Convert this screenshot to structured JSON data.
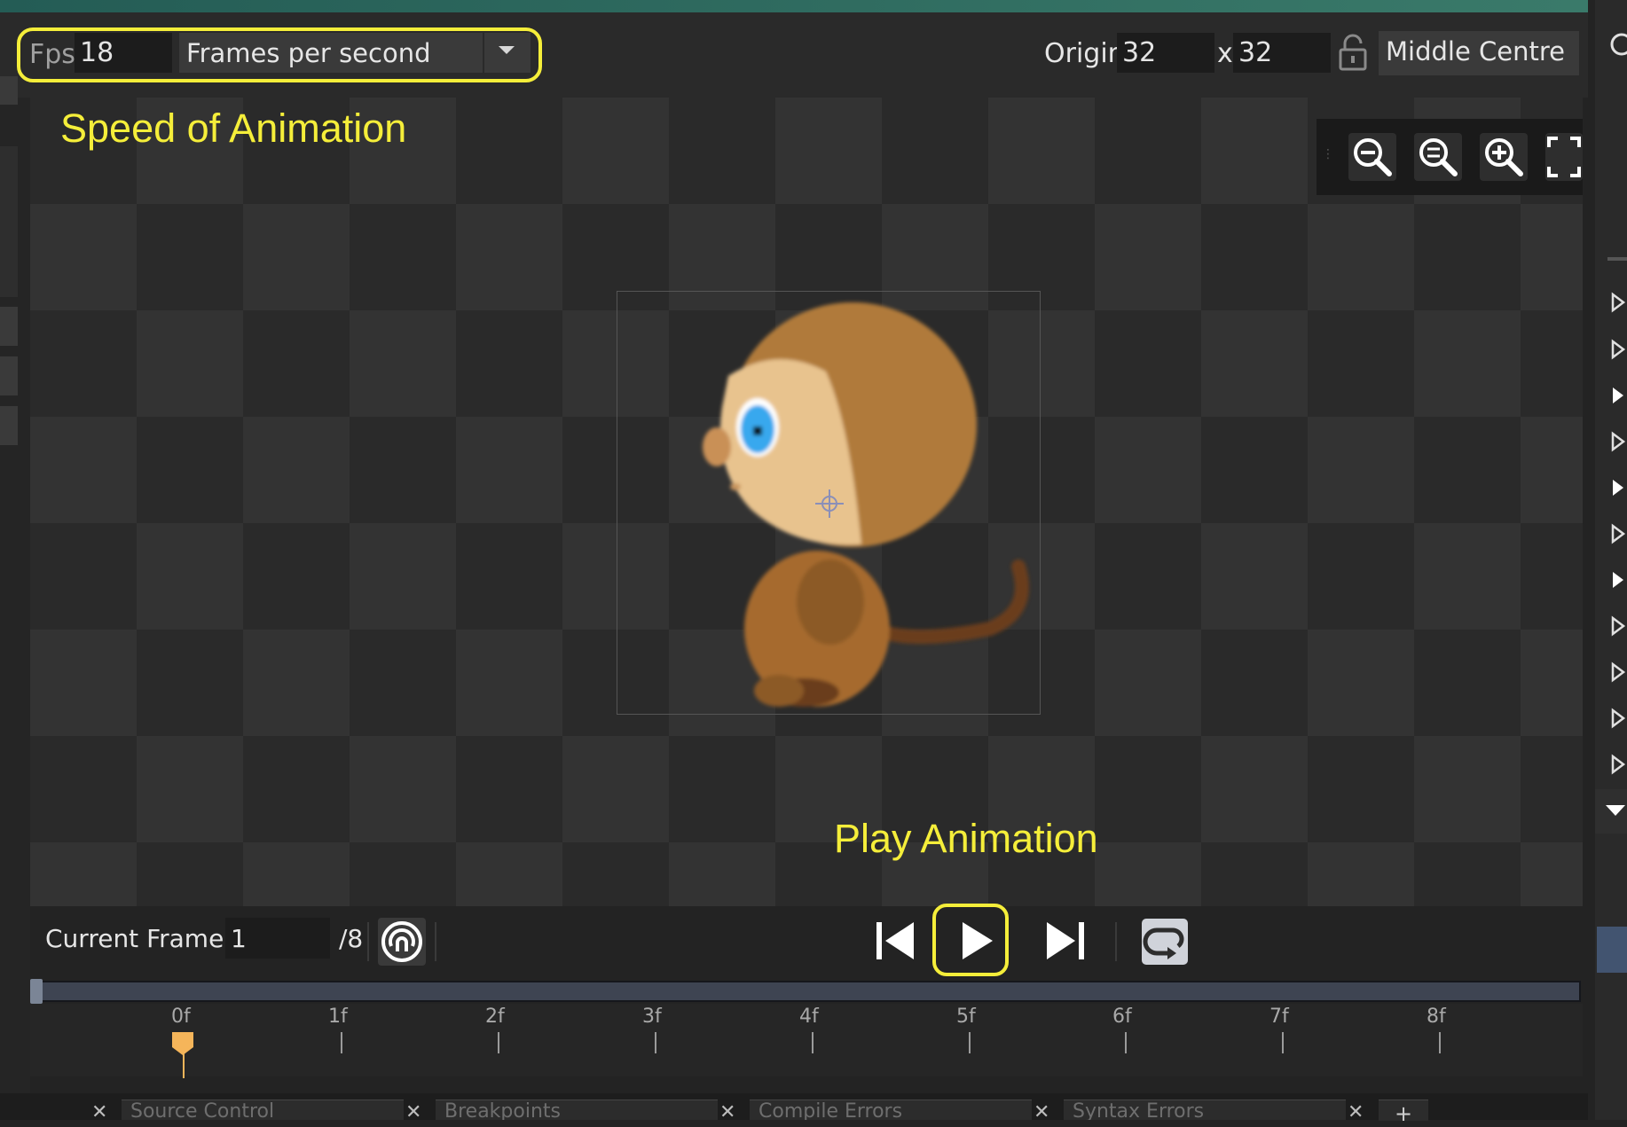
{
  "toolbar": {
    "fps_label": "Fps",
    "fps_value": "18",
    "fps_unit_selected": "Frames per second",
    "origin_label": "Origin",
    "origin_x": "32",
    "origin_separator": "x",
    "origin_y": "32",
    "origin_preset": "Middle Centre"
  },
  "annotations": {
    "speed": "Speed of Animation",
    "play": "Play Animation",
    "highlight_color": "#f5ee3a"
  },
  "zoom": {
    "buttons": [
      "zoom-out-icon",
      "zoom-reset-icon",
      "zoom-in-icon",
      "fit-to-screen-icon"
    ]
  },
  "playback": {
    "current_frame_label": "Current Frame:",
    "current_frame_value": "1",
    "total_frames": "/8",
    "buttons": [
      "onion-skin-icon",
      "skip-to-start-icon",
      "play-icon",
      "skip-to-end-icon",
      "loop-icon"
    ]
  },
  "timeline": {
    "ticks": [
      "0f",
      "1f",
      "2f",
      "3f",
      "4f",
      "5f",
      "6f",
      "7f",
      "8f"
    ],
    "current_frame_index": 0,
    "marker_color": "#f5b55a"
  },
  "bottom_tabs": [
    "Source Control",
    "Breakpoints",
    "Compile Errors",
    "Syntax Errors"
  ],
  "sprite": {
    "description_icon": "monkey-sprite"
  }
}
